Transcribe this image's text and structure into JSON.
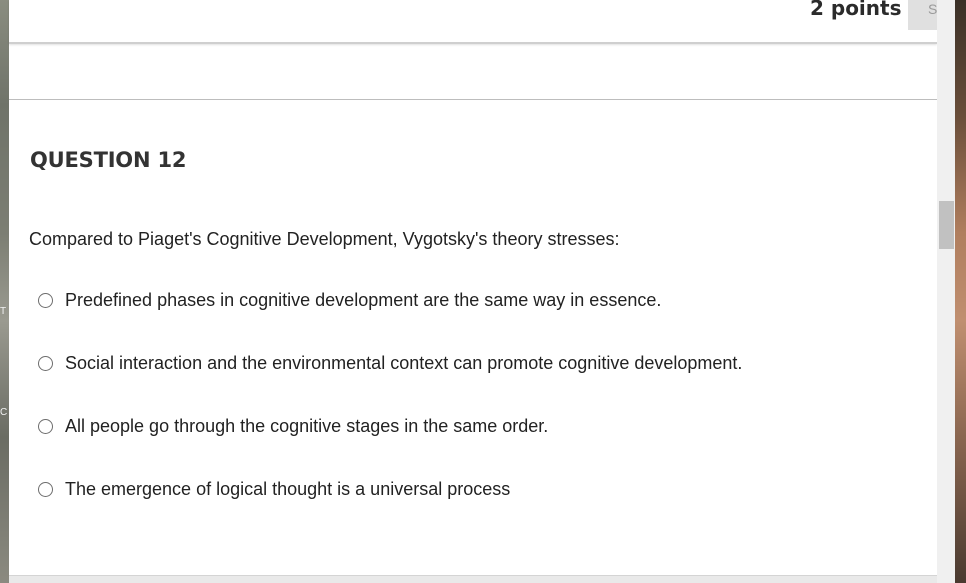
{
  "header": {
    "points": "2 points",
    "save_label": "S"
  },
  "question": {
    "title": "QUESTION 12",
    "text": "Compared to Piaget's Cognitive Development, Vygotsky's theory stresses:",
    "options": [
      "Predefined phases in cognitive development are the same way in essence.",
      "Social interaction and the environmental context can promote cognitive development.",
      "All people go through the cognitive stages in the same order.",
      "The emergence of logical thought is a universal process"
    ]
  },
  "background": {
    "left_fragments": [
      "T",
      "C"
    ]
  }
}
